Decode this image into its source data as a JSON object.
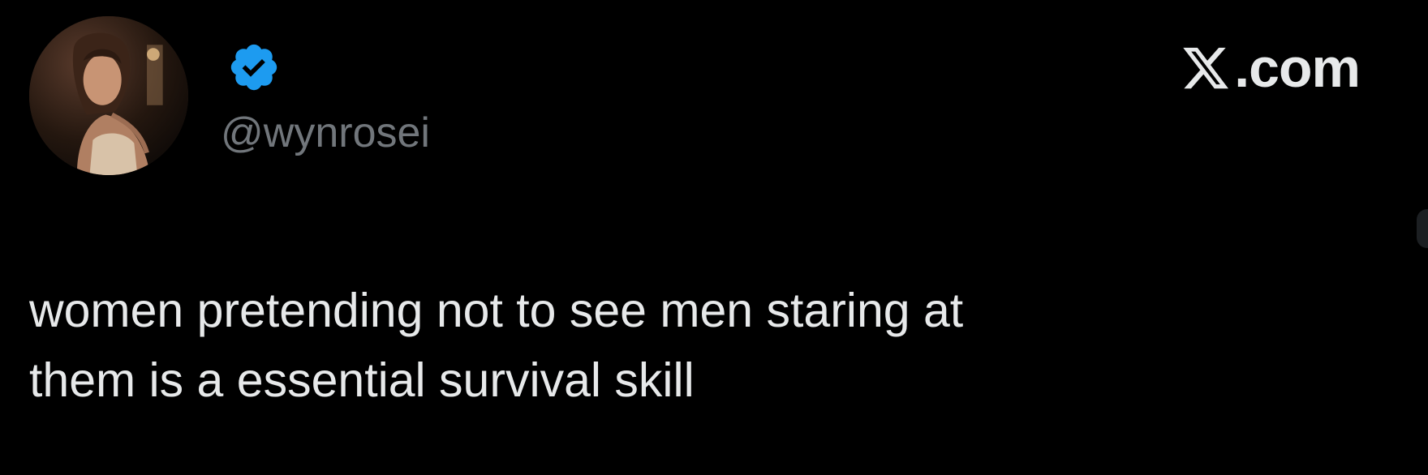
{
  "tweet": {
    "author": {
      "handle": "@wynrosei",
      "verified": true,
      "avatar_icon": "profile-photo",
      "badge_color": "#1d9bf0"
    },
    "brand": {
      "logo_icon": "x-logo-icon",
      "domain": ".com"
    },
    "text_lines": [
      "women pretending not to see men staring at",
      "them is a essential survival skill"
    ]
  },
  "colors": {
    "background": "#000000",
    "text_primary": "#e7e9ea",
    "text_secondary": "#71767b",
    "verified_blue": "#1d9bf0"
  }
}
